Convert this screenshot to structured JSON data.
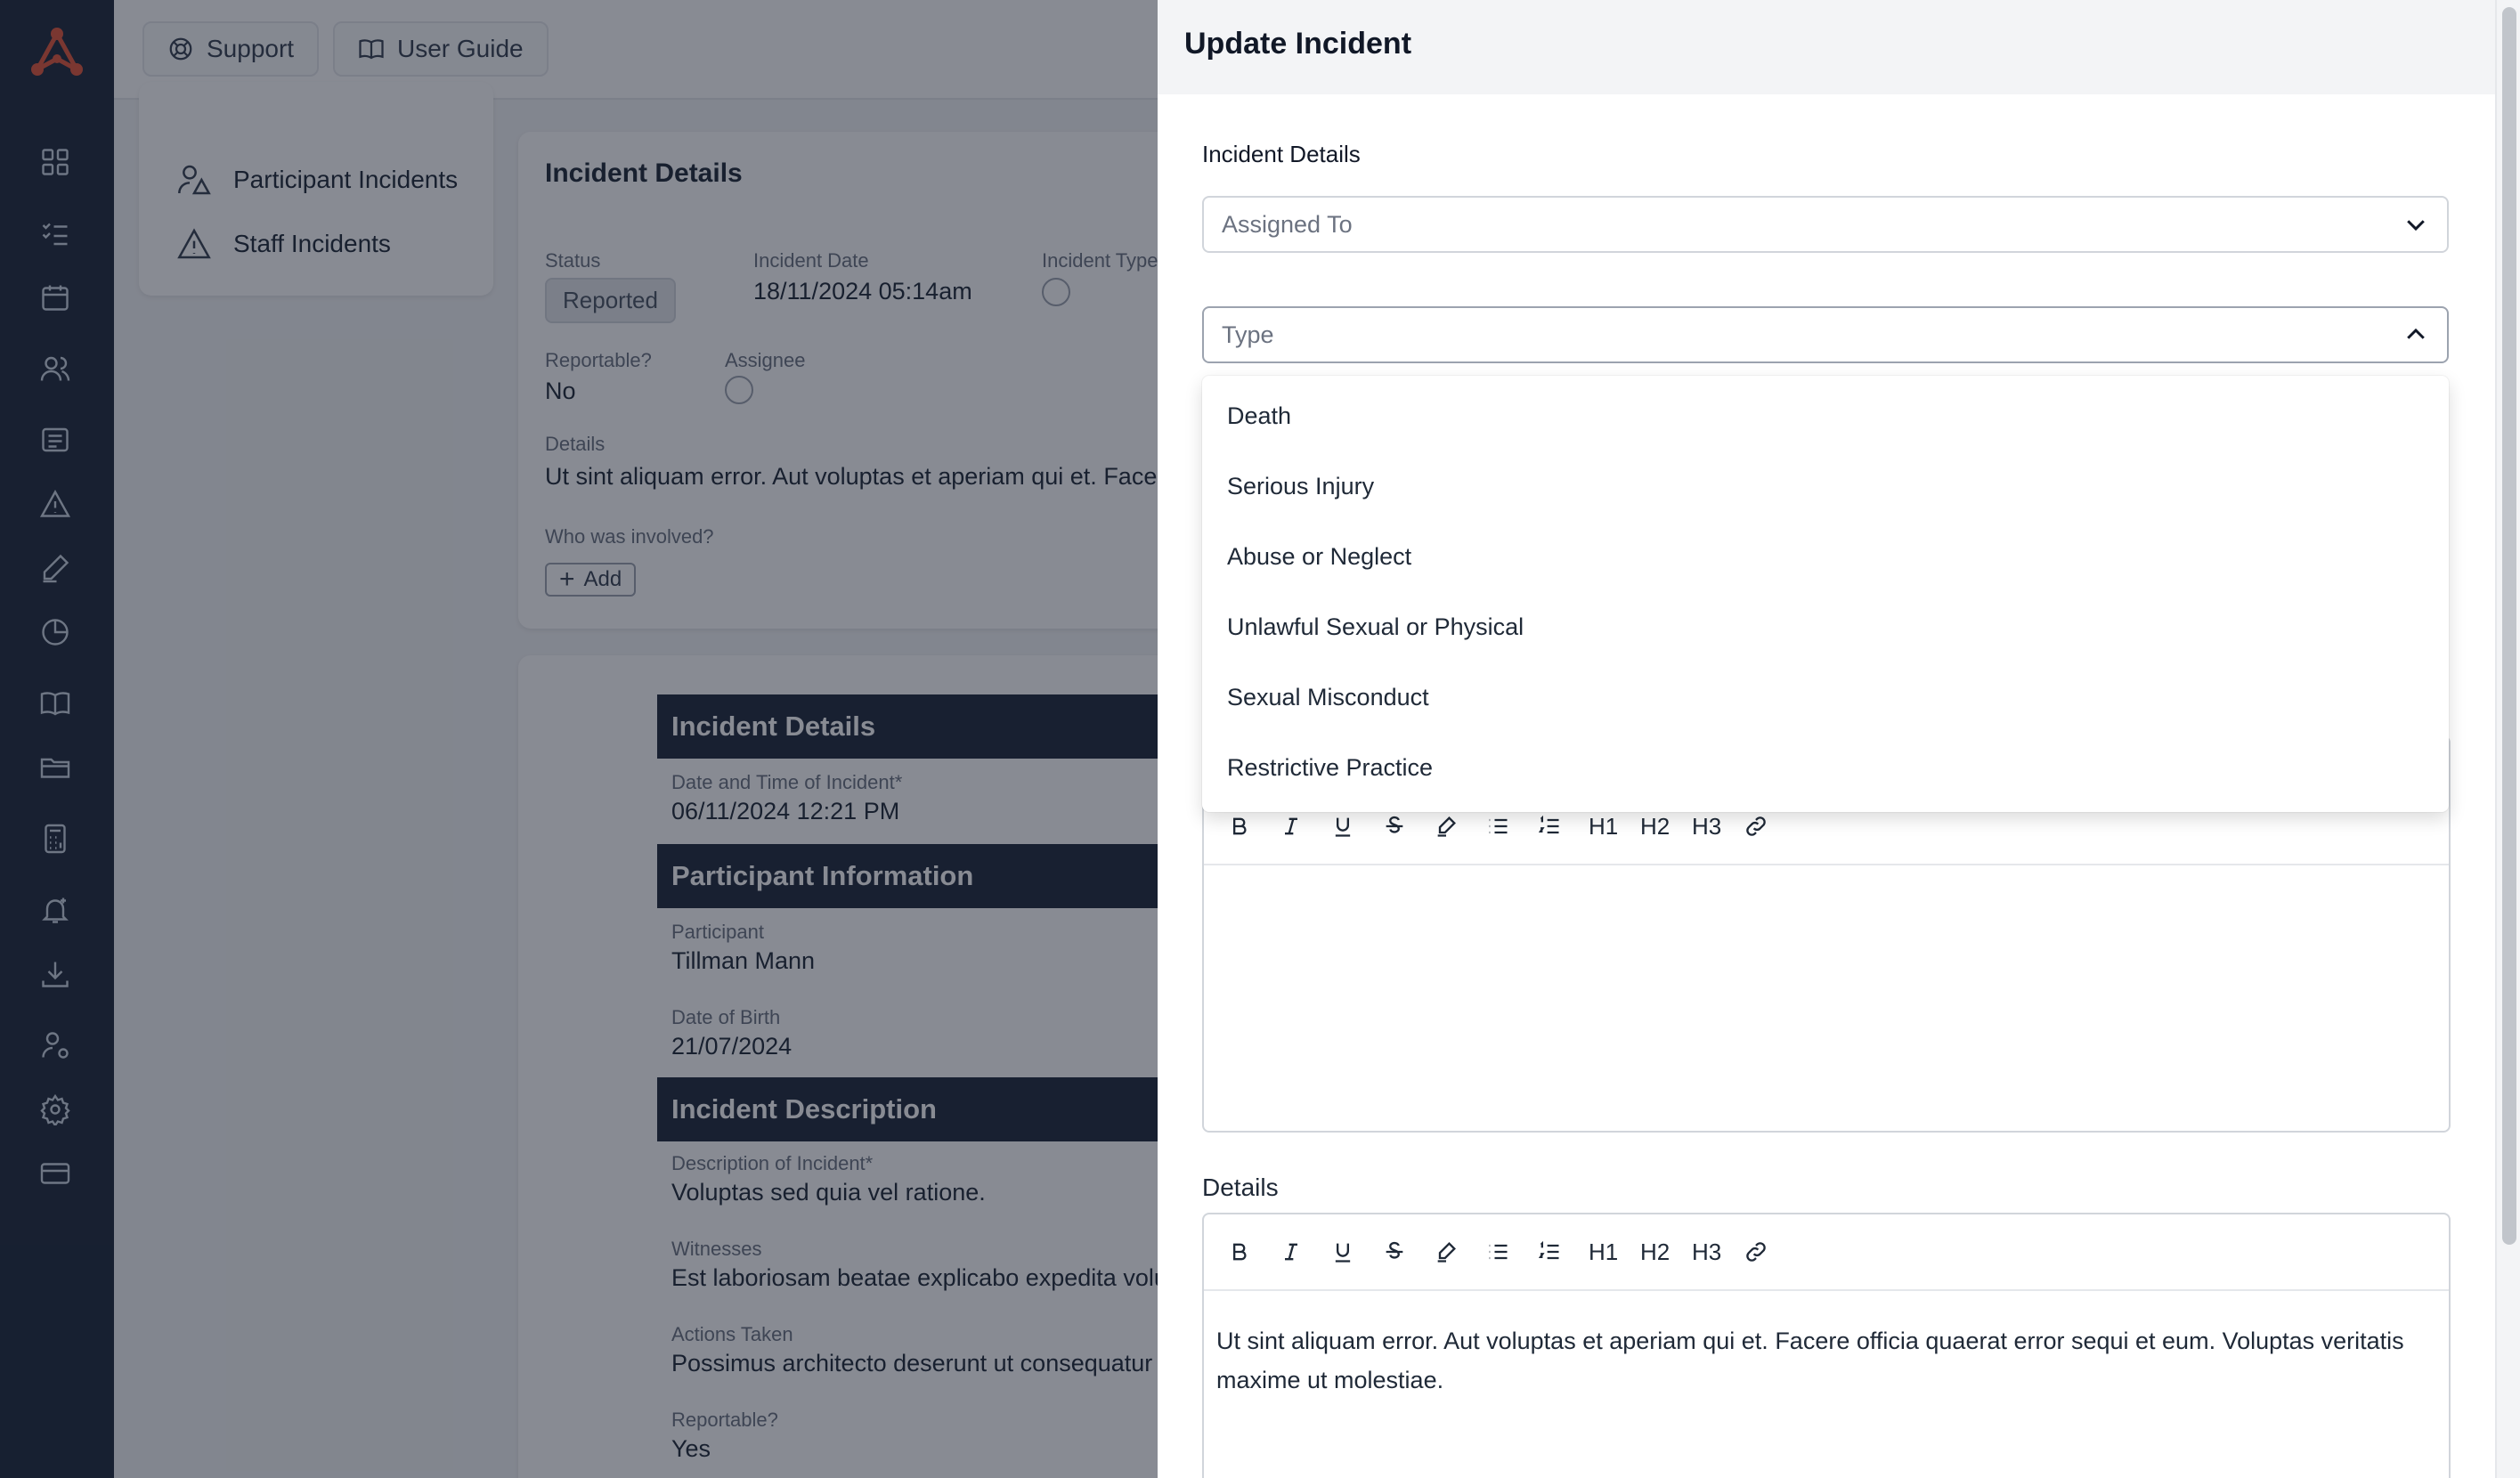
{
  "topbar": {
    "support_label": "Support",
    "guide_label": "User Guide"
  },
  "subnav": {
    "participant_label": "Participant Incidents",
    "staff_label": "Staff Incidents"
  },
  "card": {
    "title": "Incident Details",
    "status_label": "Status",
    "status_value": "Reported",
    "date_label": "Incident Date",
    "date_value": "18/11/2024 05:14am",
    "type_label": "Incident Type",
    "reportable_label": "Reportable?",
    "reportable_value": "No",
    "assignee_label": "Assignee",
    "details_label": "Details",
    "details_value": "Ut sint aliquam error. Aut voluptas et aperiam qui et. Facere",
    "involved_label": "Who was involved?",
    "add_label": "Add"
  },
  "doc": {
    "section1": "Incident Details",
    "datetime_label": "Date and Time of Incident*",
    "datetime_value": "06/11/2024 12:21 PM",
    "section2": "Participant Information",
    "participant_label": "Participant",
    "participant_value": "Tillman Mann",
    "dob_label": "Date of Birth",
    "dob_value": "21/07/2024",
    "section3": "Incident Description",
    "desc_label": "Description of Incident*",
    "desc_value": "Voluptas sed quia vel ratione.",
    "witness_label": "Witnesses",
    "witness_value": "Est laboriosam beatae explicabo expedita volu",
    "actions_label": "Actions Taken",
    "actions_value": "Possimus architecto deserunt ut consequatur",
    "reportable_label": "Reportable?",
    "reportable_value": "Yes"
  },
  "drawer": {
    "title": "Update Incident",
    "section_label": "Incident Details",
    "assigned_placeholder": "Assigned To",
    "type_placeholder": "Type",
    "type_options": [
      "Death",
      "Serious Injury",
      "Abuse or Neglect",
      "Unlawful Sexual or Physical",
      "Sexual Misconduct",
      "Restrictive Practice"
    ],
    "toolbar": {
      "h1": "H1",
      "h2": "H2",
      "h3": "H3"
    },
    "details_label": "Details",
    "details_text": "Ut sint aliquam error. Aut voluptas et aperiam qui et. Facere officia quaerat error sequi et eum. Voluptas veritatis maxime ut molestiae."
  },
  "colors": {
    "rail": "#1e293b",
    "accent": "#e2573b",
    "overlay": "rgba(17,24,39,0.5)"
  },
  "icons": [
    "app-logo",
    "dashboard-icon",
    "tasks-icon",
    "calendar-icon",
    "users-icon",
    "list-icon",
    "warning-icon",
    "pen-icon",
    "chart-icon",
    "book-icon",
    "folder-icon",
    "calculator-icon",
    "bell-icon",
    "download-icon",
    "user-settings-icon",
    "gear-icon",
    "card-icon"
  ]
}
